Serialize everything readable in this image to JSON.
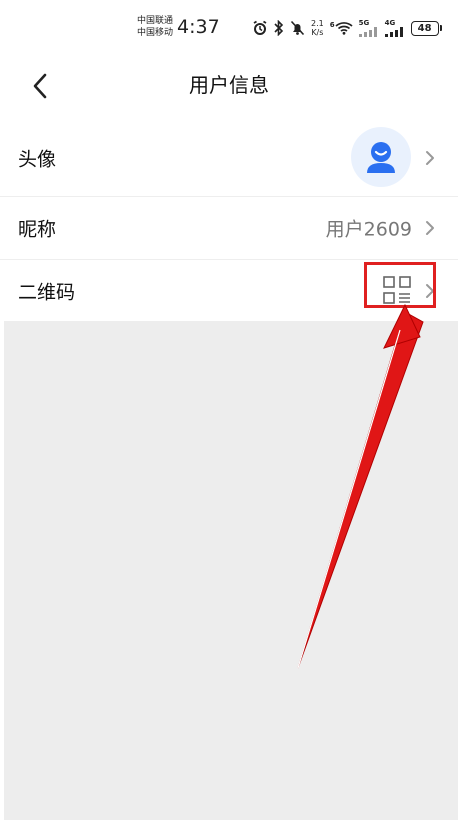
{
  "status_bar": {
    "carrier_1": "中国联通",
    "carrier_2": "中国移动",
    "time": "4:37",
    "speed_value": "2.1",
    "speed_unit": "K/s",
    "wifi_label": "6",
    "net_5g": "5G",
    "net_4g": "4G",
    "battery": "48"
  },
  "header": {
    "title": "用户信息"
  },
  "rows": {
    "avatar_label": "头像",
    "nickname_label": "昵称",
    "nickname_value": "用户2609",
    "qrcode_label": "二维码"
  },
  "colors": {
    "accent": "#2a6ff0",
    "highlight": "#e02020",
    "gray_bg": "#ededed"
  }
}
